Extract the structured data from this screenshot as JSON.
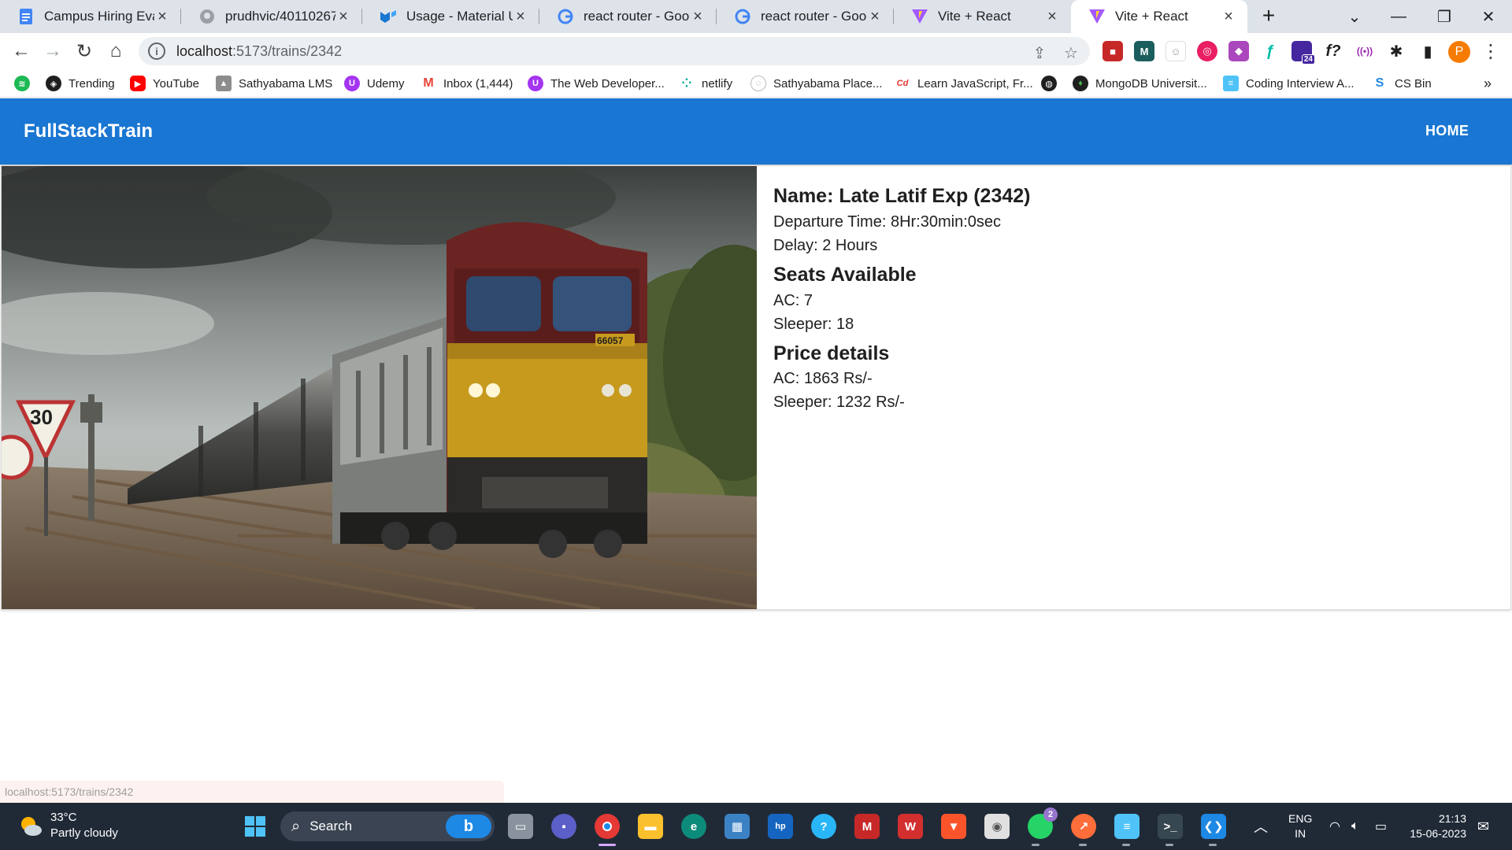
{
  "browser": {
    "tabs": [
      {
        "label": "Campus Hiring Evalua",
        "icon": "google-docs-icon"
      },
      {
        "label": "prudhvic/40110267",
        "icon": "github-icon"
      },
      {
        "label": "Usage - Material UI",
        "icon": "material-ui-icon"
      },
      {
        "label": "react router - Google",
        "icon": "google-icon"
      },
      {
        "label": "react router - Google",
        "icon": "google-icon"
      },
      {
        "label": "Vite + React",
        "icon": "vite-icon"
      },
      {
        "label": "Vite + React",
        "icon": "vite-icon",
        "active": true
      }
    ],
    "new_tab": "+",
    "url_host": "localhost",
    "url_path": ":5173/trains/2342",
    "bookmarks": [
      {
        "label": "",
        "icon": "spotify-icon"
      },
      {
        "label": "Trending",
        "icon": "trending-icon"
      },
      {
        "label": "YouTube",
        "icon": "youtube-icon"
      },
      {
        "label": "Sathyabama LMS",
        "icon": "lms-icon"
      },
      {
        "label": "Udemy",
        "icon": "udemy-icon"
      },
      {
        "label": "Inbox (1,444)",
        "icon": "gmail-icon"
      },
      {
        "label": "The Web Developer...",
        "icon": "udemy-icon"
      },
      {
        "label": "netlify",
        "icon": "netlify-icon"
      },
      {
        "label": "Sathyabama Place...",
        "icon": "placement-icon"
      },
      {
        "label": "Learn JavaScript, Fr...",
        "icon": "codecademy-icon"
      },
      {
        "label": "",
        "icon": "globe-icon"
      },
      {
        "label": "MongoDB Universit...",
        "icon": "mongodb-icon"
      },
      {
        "label": "Coding Interview A...",
        "icon": "coding-interview-icon"
      },
      {
        "label": "CS Bin",
        "icon": "csbin-icon"
      }
    ],
    "more_bookmarks": "»",
    "profile_initial": "P",
    "ext_badge": "24",
    "status_url": "localhost:5173/trains/2342"
  },
  "app": {
    "brand": "FullStackTrain",
    "nav_home": "HOME"
  },
  "train": {
    "name_line": "Name: Late Latif Exp (2342)",
    "departure": "Departure Time: 8Hr:30min:0sec",
    "delay": "Delay: 2 Hours",
    "seats_heading": "Seats Available",
    "seats_ac": "AC: 7",
    "seats_sleeper": "Sleeper: 18",
    "price_heading": "Price details",
    "price_ac": "AC: 1863 Rs/-",
    "price_sleeper": "Sleeper: 1232 Rs/-",
    "image_loco_number": "66057",
    "image_sign_value": "30"
  },
  "taskbar": {
    "temperature": "33°C",
    "condition": "Partly cloudy",
    "search_label": "Search",
    "whatsapp_badge": "2",
    "language": "ENG",
    "region": "IN",
    "time": "21:13",
    "date": "15-06-2023"
  },
  "colors": {
    "appbar": "#1976d2",
    "tabstrip": "#dee3ea",
    "taskbar": "#202a37"
  }
}
